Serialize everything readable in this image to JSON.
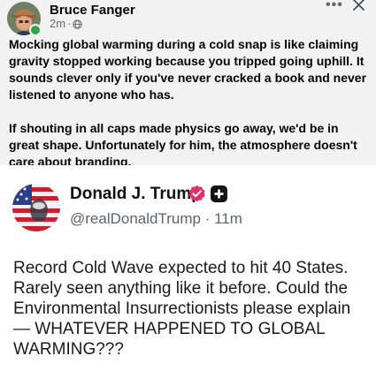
{
  "facebook_post": {
    "author": "Bruce Fanger",
    "time": "2m",
    "more_icon": "•••",
    "colors": {
      "background": "#f2f2f2",
      "online": "#31a24c"
    },
    "paragraphs": [
      "Mocking global warming during a cold snap is like claiming gravity stopped working because you tripped going uphill. It sounds clever only if you've never cracked a book and never listened to anyone who has.",
      "If shouting in all caps made physics go away, we'd be in great shape. Unfortunately for him, the atmosphere doesn't care about branding."
    ],
    "icons": [
      "avatar",
      "online-status-icon",
      "globe-icon",
      "more-options-icon",
      "close-icon"
    ]
  },
  "truth_post": {
    "name": "Donald J. Trump",
    "handle": "@realDonaldTrump",
    "separator": "·",
    "time": "11m",
    "colors": {
      "verified_badge": "#e0306a",
      "plus_badge": "#141414"
    },
    "content": "Record Cold Wave expected to hit 40 States. Rarely seen anything like it before. Could the Environmental Insurrectionists please explain — WHATEVER HAPPENED TO GLOBAL WARMING???",
    "icons": [
      "profile-avatar",
      "verified-badge-icon",
      "plus-badge-icon"
    ]
  }
}
